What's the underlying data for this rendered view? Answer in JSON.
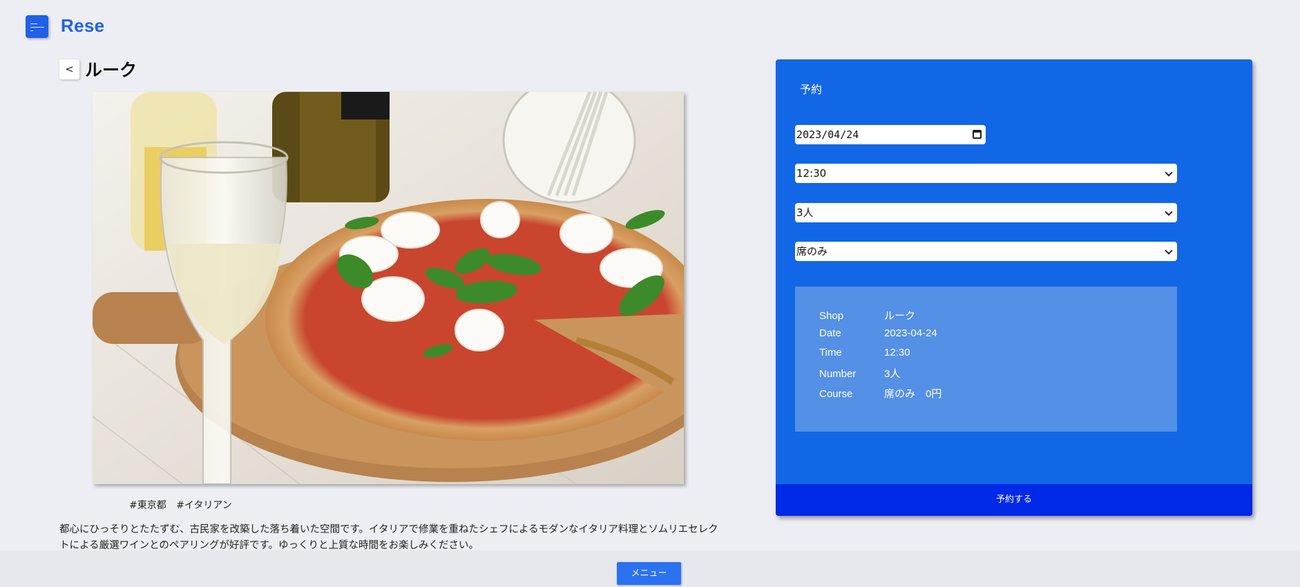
{
  "app": {
    "logo_text": "Rese",
    "accent_color": "#2160e8",
    "menu_icon": "hamburger-menu-icon"
  },
  "shop": {
    "back_label": "<",
    "name": "ルーク",
    "image_alt": "pizza-with-wine-photo",
    "tags": [
      "#東京都",
      "#イタリアン"
    ],
    "description": "都心にひっそりとたたずむ、古民家を改築した落ち着いた空間です。イタリアで修業を重ねたシェフによるモダンなイタリア料理とソムリエセレクトによる厳選ワインとのペアリングが好評です。ゆっくりと上質な時間をお楽しみください。"
  },
  "reservation": {
    "title": "予約",
    "date_value": "2023/04/24",
    "time_value": "12:30",
    "number_value": "3人",
    "course_value": "席のみ",
    "panel_color": "#1267e6",
    "summary": {
      "shop_label": "Shop",
      "shop_value": "ルーク",
      "date_label": "Date",
      "date_value": "2023-04-24",
      "time_label": "Time",
      "time_value": "12:30",
      "number_label": "Number",
      "number_value": "3人",
      "course_label": "Course",
      "course_value": "席のみ　0円"
    },
    "submit_label": "予約する",
    "submit_color": "#0029e8"
  },
  "footer": {
    "menu_label": "メニュー"
  }
}
